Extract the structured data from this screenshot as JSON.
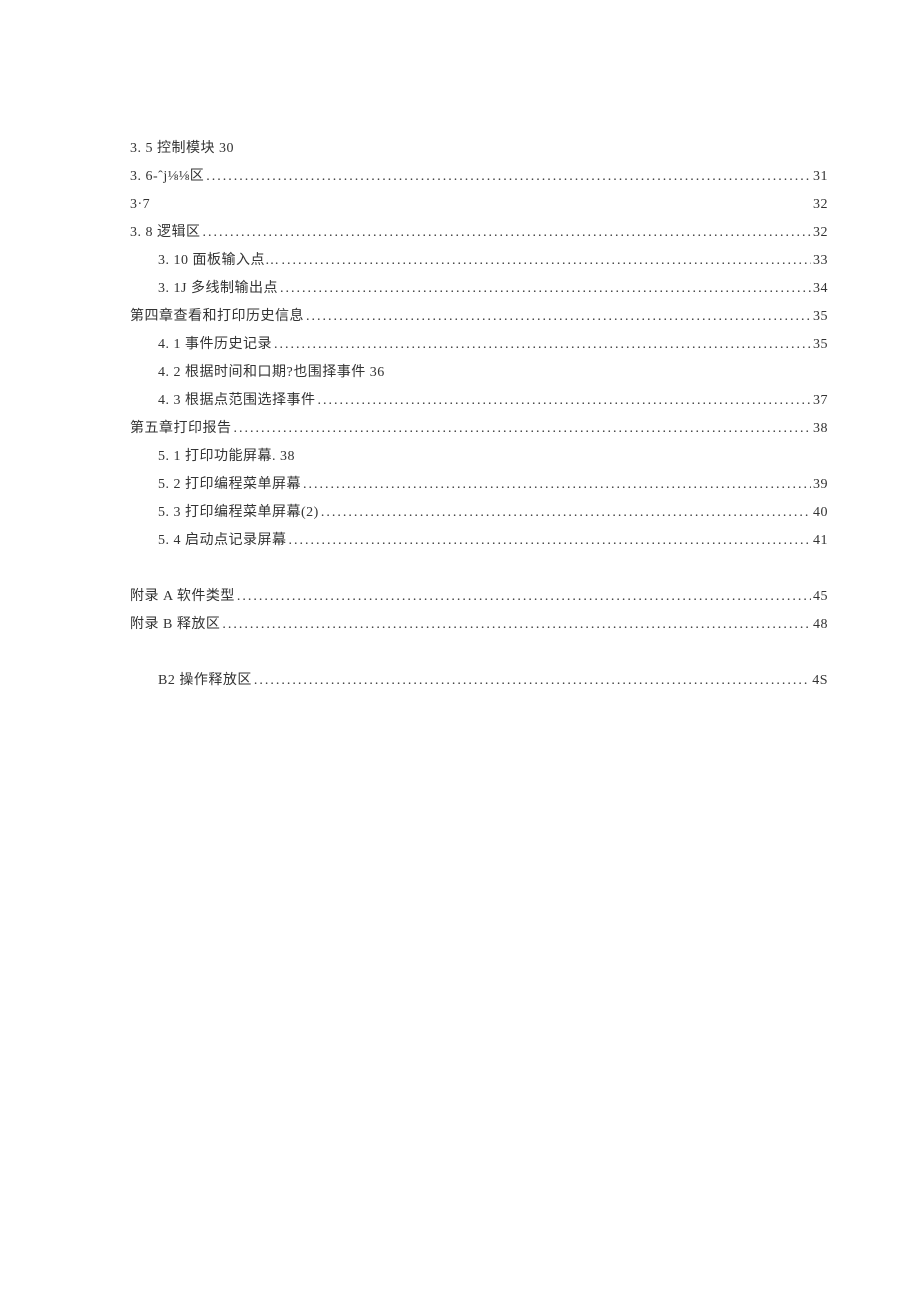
{
  "toc": [
    {
      "label": "3. 5 控制模块 30",
      "page": "",
      "indent": 1,
      "dots": false
    },
    {
      "label": "3. 6-ˆj⅛⅛区",
      "page": "31",
      "indent": 1,
      "dots": true
    },
    {
      "label": "3·7",
      "page": "32",
      "indent": 1,
      "dots": false
    },
    {
      "label": "3. 8 逻辑区",
      "page": "32",
      "indent": 1,
      "dots": true
    },
    {
      "label": "3. 10 面板输入点…",
      "page": "33",
      "indent": 2,
      "dots": true
    },
    {
      "label": "3. 1J 多线制输出点",
      "page": "34",
      "indent": 2,
      "dots": true
    },
    {
      "label": "第四章查看和打印历史信息",
      "page": "35",
      "indent": 1,
      "dots": true
    },
    {
      "label": "4. 1 事件历史记录",
      "page": "35",
      "indent": 2,
      "dots": true
    },
    {
      "label": "4. 2 根据时间和口期?也围择事件 36",
      "page": "",
      "indent": 2,
      "dots": false
    },
    {
      "label": "4. 3 根据点范围选择事件",
      "page": "37",
      "indent": 2,
      "dots": true
    },
    {
      "label": "第五章打印报告",
      "page": "38",
      "indent": 1,
      "dots": true
    },
    {
      "label": "5. 1 打印功能屏幕. 38",
      "page": "",
      "indent": 2,
      "dots": false
    },
    {
      "label": "5. 2 打印编程菜单屏幕",
      "page": "39",
      "indent": 2,
      "dots": true
    },
    {
      "label": "5. 3 打印编程菜单屏幕(2)",
      "page": "40",
      "indent": 2,
      "dots": true
    },
    {
      "label": "5. 4 启动点记录屏幕",
      "page": "41",
      "indent": 2,
      "dots": true
    },
    {
      "gap": true
    },
    {
      "label": "附录 A 软件类型",
      "page": "45",
      "indent": 1,
      "dots": true
    },
    {
      "label": "附录 B 释放区",
      "page": "48",
      "indent": 1,
      "dots": true
    },
    {
      "gap": true
    },
    {
      "label": "B2 操作释放区",
      "page": "4S",
      "indent": 2,
      "dots": true
    }
  ]
}
